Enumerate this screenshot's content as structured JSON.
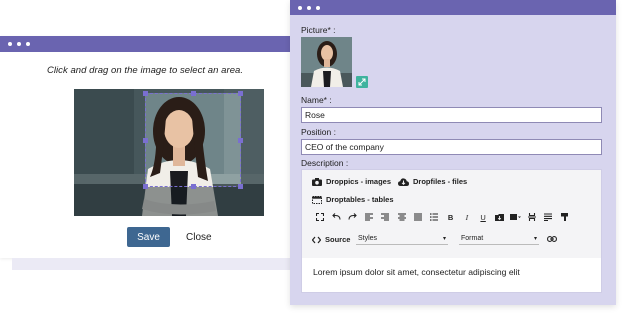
{
  "crop_dialog": {
    "instructions": "Click and drag on the image to select an area.",
    "save_label": "Save",
    "close_label": "Close"
  },
  "form": {
    "picture_label": "Picture* :",
    "name_label": "Name* :",
    "name_value": "Rose",
    "position_label": "Position :",
    "position_value": "CEO of the company",
    "description_label": "Description :",
    "editor": {
      "droppics_label": "Droppics - images",
      "dropfiles_label": "Dropfiles - files",
      "droptables_label": "Droptables - tables",
      "source_label": "Source",
      "styles_select": "Styles",
      "format_select": "Format",
      "content": "Lorem ipsum dolor sit amet, consectetur adipiscing elit"
    }
  },
  "colors": {
    "titlebar": "#6a64b0",
    "form_bg": "#d7d5ee",
    "save_button": "#3e6791",
    "accent_icon": "#3fb39e"
  }
}
